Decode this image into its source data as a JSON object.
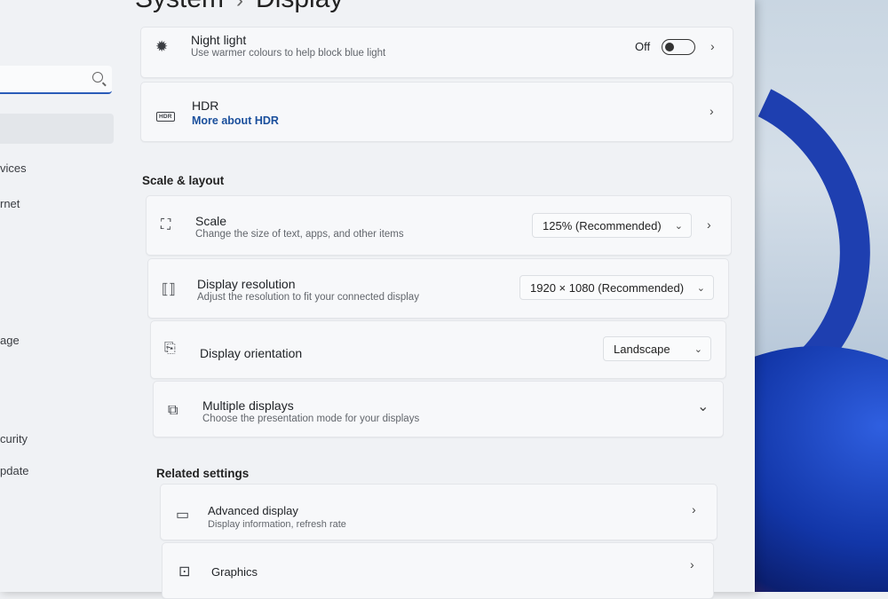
{
  "window": {
    "breadcrumb_parent": "System",
    "breadcrumb_separator": "›",
    "breadcrumb_current": "Display"
  },
  "sidebar": {
    "search_placeholder": "",
    "items": [
      {
        "label": "vices"
      },
      {
        "label": "rnet"
      },
      {
        "label": "age"
      },
      {
        "label": "curity"
      },
      {
        "label": "pdate"
      }
    ]
  },
  "night_light": {
    "title": "Night light",
    "subtitle": "Use warmer colours to help block blue light",
    "toggle_state": "Off",
    "enabled": false
  },
  "hdr": {
    "title": "HDR",
    "link": "More about HDR",
    "icon_text": "HDR"
  },
  "scale_layout": {
    "heading": "Scale & layout",
    "scale": {
      "title": "Scale",
      "subtitle": "Change the size of text, apps, and other items",
      "value": "125% (Recommended)"
    },
    "resolution": {
      "title": "Display resolution",
      "subtitle": "Adjust the resolution to fit your connected display",
      "value": "1920 × 1080 (Recommended)"
    },
    "orientation": {
      "title": "Display orientation",
      "value": "Landscape"
    },
    "multiple_displays": {
      "title": "Multiple displays",
      "subtitle": "Choose the presentation mode for your displays"
    }
  },
  "related": {
    "heading": "Related settings",
    "advanced_display": {
      "title": "Advanced display",
      "subtitle": "Display information, refresh rate"
    },
    "graphics": {
      "title": "Graphics"
    }
  },
  "icons": {
    "chevron_right": "›",
    "chevron_down": "⌄"
  },
  "colors": {
    "accent": "#2a5bb8",
    "link": "#1a4f9c"
  }
}
